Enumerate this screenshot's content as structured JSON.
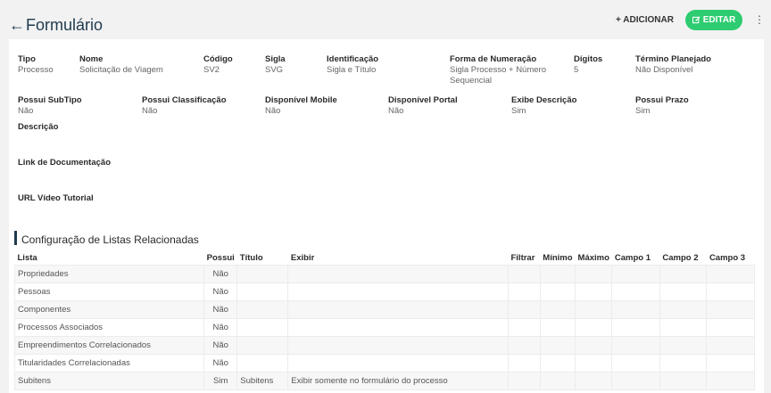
{
  "header": {
    "title": "Formulário",
    "add_label": "+ ADICIONAR",
    "edit_label": "EDITAR"
  },
  "fields": {
    "tipo": {
      "label": "Tipo",
      "value": "Processo"
    },
    "nome": {
      "label": "Nome",
      "value": "Solicitação de Viagem"
    },
    "codigo": {
      "label": "Código",
      "value": "SV2"
    },
    "sigla": {
      "label": "Sigla",
      "value": "SVG"
    },
    "identificacao": {
      "label": "Identificação",
      "value": "Sigla e Título"
    },
    "forma_numeracao": {
      "label": "Forma de Numeração",
      "value_line1": "Sigla Processo + Número",
      "value_line2": "Sequencial"
    },
    "digitos": {
      "label": "Dígitos",
      "value": "5"
    },
    "termino_planejado": {
      "label": "Término Planejado",
      "value": "Não Disponível"
    },
    "possui_subtipo": {
      "label": "Possui SubTipo",
      "value": "Não"
    },
    "possui_classificacao": {
      "label": "Possui Classificação",
      "value": "Não"
    },
    "disponivel_mobile": {
      "label": "Disponível Mobile",
      "value": "Não"
    },
    "disponivel_portal": {
      "label": "Disponível Portal",
      "value": "Não"
    },
    "exibe_descricao": {
      "label": "Exibe Descrição",
      "value": "Sim"
    },
    "possui_prazo": {
      "label": "Possui Prazo",
      "value": "Sim"
    },
    "descricao": {
      "label": "Descrição"
    },
    "link_documentacao": {
      "label": "Link de Documentação"
    },
    "url_video": {
      "label": "URL Vídeo Tutorial"
    }
  },
  "section": {
    "title": "Configuração de Listas Relacionadas"
  },
  "table": {
    "headers": [
      "Lista",
      "Possui",
      "Título",
      "Exibir",
      "Filtrar",
      "Mínimo",
      "Máximo",
      "Campo 1",
      "Campo 2",
      "Campo 3"
    ],
    "rows": [
      {
        "lista": "Propriedades",
        "possui": "Não",
        "titulo": "",
        "exibir": ""
      },
      {
        "lista": "Pessoas",
        "possui": "Não",
        "titulo": "",
        "exibir": ""
      },
      {
        "lista": "Componentes",
        "possui": "Não",
        "titulo": "",
        "exibir": ""
      },
      {
        "lista": "Processos Associados",
        "possui": "Não",
        "titulo": "",
        "exibir": ""
      },
      {
        "lista": "Empreendimentos Correlacionados",
        "possui": "Não",
        "titulo": "",
        "exibir": ""
      },
      {
        "lista": "Titularidades Correlacionadas",
        "possui": "Não",
        "titulo": "",
        "exibir": ""
      },
      {
        "lista": "Subitens",
        "possui": "Sim",
        "titulo": "Subitens",
        "exibir": "Exibir somente no formulário do processo"
      }
    ]
  },
  "icons": {
    "back": "arrow-left-icon",
    "edit": "edit-icon",
    "more": "kebab-menu-icon"
  },
  "colors": {
    "accent": "#2ecc71",
    "title": "#1f3a4d"
  }
}
